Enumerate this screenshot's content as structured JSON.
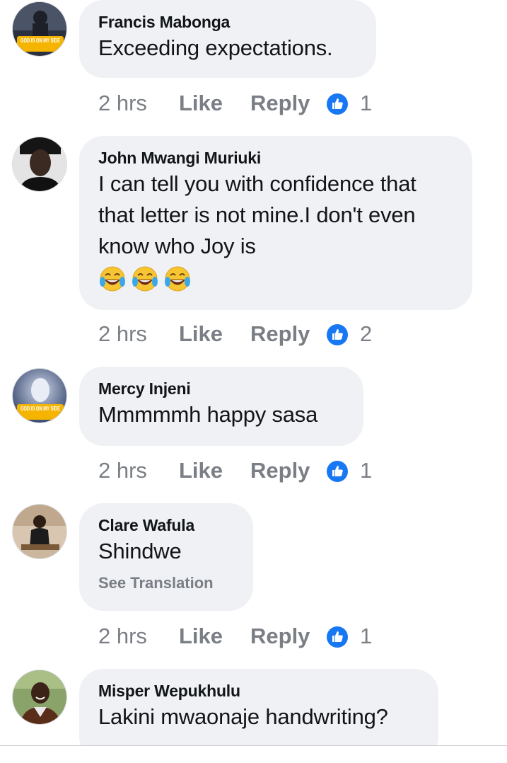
{
  "comments": [
    {
      "author": "Francis Mabonga",
      "avatar": "avatar-god-is-on-my-side",
      "avatar_badge": "GOD IS ON MY SIDE",
      "text": "Exceeding expectations.",
      "time": "2 hrs",
      "like_label": "Like",
      "reply_label": "Reply",
      "reactions": "1"
    },
    {
      "author": "John Mwangi Muriuki",
      "avatar": "avatar-man-portrait",
      "text_lines": [
        "I can tell you with confidence that",
        "that letter is not mine.I don't even",
        "know who Joy is"
      ],
      "emoji": [
        "face-with-tears-of-joy",
        "face-with-tears-of-joy",
        "face-with-tears-of-joy"
      ],
      "time": "2 hrs",
      "like_label": "Like",
      "reply_label": "Reply",
      "reactions": "2"
    },
    {
      "author": "Mercy Injeni",
      "avatar": "avatar-god-is-on-my-side",
      "avatar_badge": "GOD IS ON MY SIDE",
      "text": "Mmmmmh happy sasa",
      "time": "2 hrs",
      "like_label": "Like",
      "reply_label": "Reply",
      "reactions": "1"
    },
    {
      "author": "Clare Wafula",
      "avatar": "avatar-woman-sitting",
      "text": "Shindwe",
      "see_translation": "See Translation",
      "time": "2 hrs",
      "like_label": "Like",
      "reply_label": "Reply",
      "reactions": "1"
    },
    {
      "author": "Misper Wepukhulu",
      "avatar": "avatar-smiling-person",
      "text": "Lakini mwaonaje handwriting?"
    }
  ],
  "colors": {
    "bubble": "#eff1f4",
    "meta_text": "#7a7e85",
    "like_blue": "#1877f2",
    "text": "#111418"
  }
}
